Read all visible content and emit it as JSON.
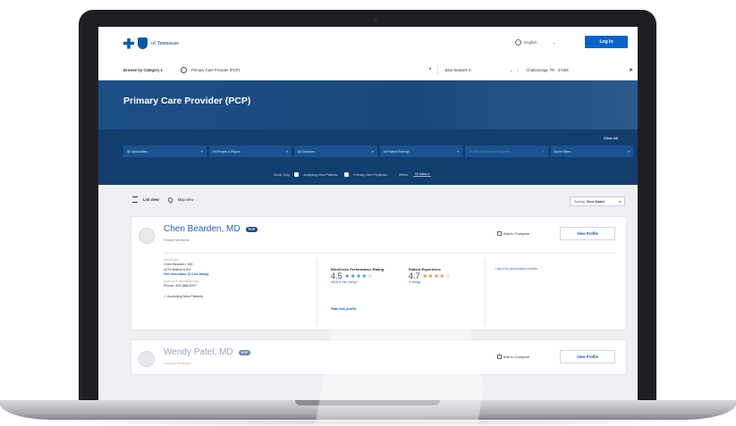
{
  "brand": {
    "logo_text": "of Tennessee",
    "color_primary": "#0a64c8",
    "color_navy": "#123e6e"
  },
  "header": {
    "language": "English",
    "login_label": "Log In"
  },
  "search": {
    "browse_label": "Browse by Category",
    "query": "Primary Care Provider (PCP)",
    "network": "Blue Network S",
    "location": "Chattanooga, TN - 37406"
  },
  "hero": {
    "title": "Primary Care Provider (PCP)"
  },
  "filters": {
    "clear_all": "Clear All",
    "selects": [
      "All Specialities",
      "All People & Places",
      "All Genders",
      "All Patient Ratings",
      "All Blue Distinction Programs",
      "More Filters"
    ],
    "show_only_label": "Show Only:",
    "accepting_label": "Accepting New Patients",
    "pcp_label": "Primary Care Physician",
    "within_label": "Within:",
    "within_value": "10 miles"
  },
  "results": {
    "list_view": "List view",
    "map_view": "Map view",
    "sort_label": "Sort by:",
    "sort_value": "Best Match"
  },
  "providers": [
    {
      "name": "Chen Bearden, MD",
      "badge": "PCP",
      "specialty": "Family Medicine",
      "compare_label": "Add to Compare",
      "view_label": "View Profile",
      "location_label": "LOCATION",
      "location_name": "Chen Bearden, MD",
      "address": "4375 Brainerd Rd",
      "directions": "Get directions (3.1 mi away)",
      "contact_label": "CONTACT INFORMATION",
      "phone": "Phone: 423-888-9097",
      "accepting": "Accepting New Patients",
      "bcbs_title": "BlueCross Performance Rating",
      "bcbs_rating": "4.5",
      "bcbs_stars": "★★★★☆",
      "bcbs_link": "What is this rating?",
      "pe_title": "Patient Experience",
      "pe_rating": "4.7",
      "pe_stars": "★★★★☆",
      "pe_link": "8 ratings",
      "rate_link": "Rate this profile",
      "login_results": "Log in for personalized results"
    },
    {
      "name": "Wendy Patel, MD",
      "badge": "PCP",
      "specialty": "Internal Medicine",
      "compare_label": "Add to Compare",
      "view_label": "View Profile"
    }
  ]
}
